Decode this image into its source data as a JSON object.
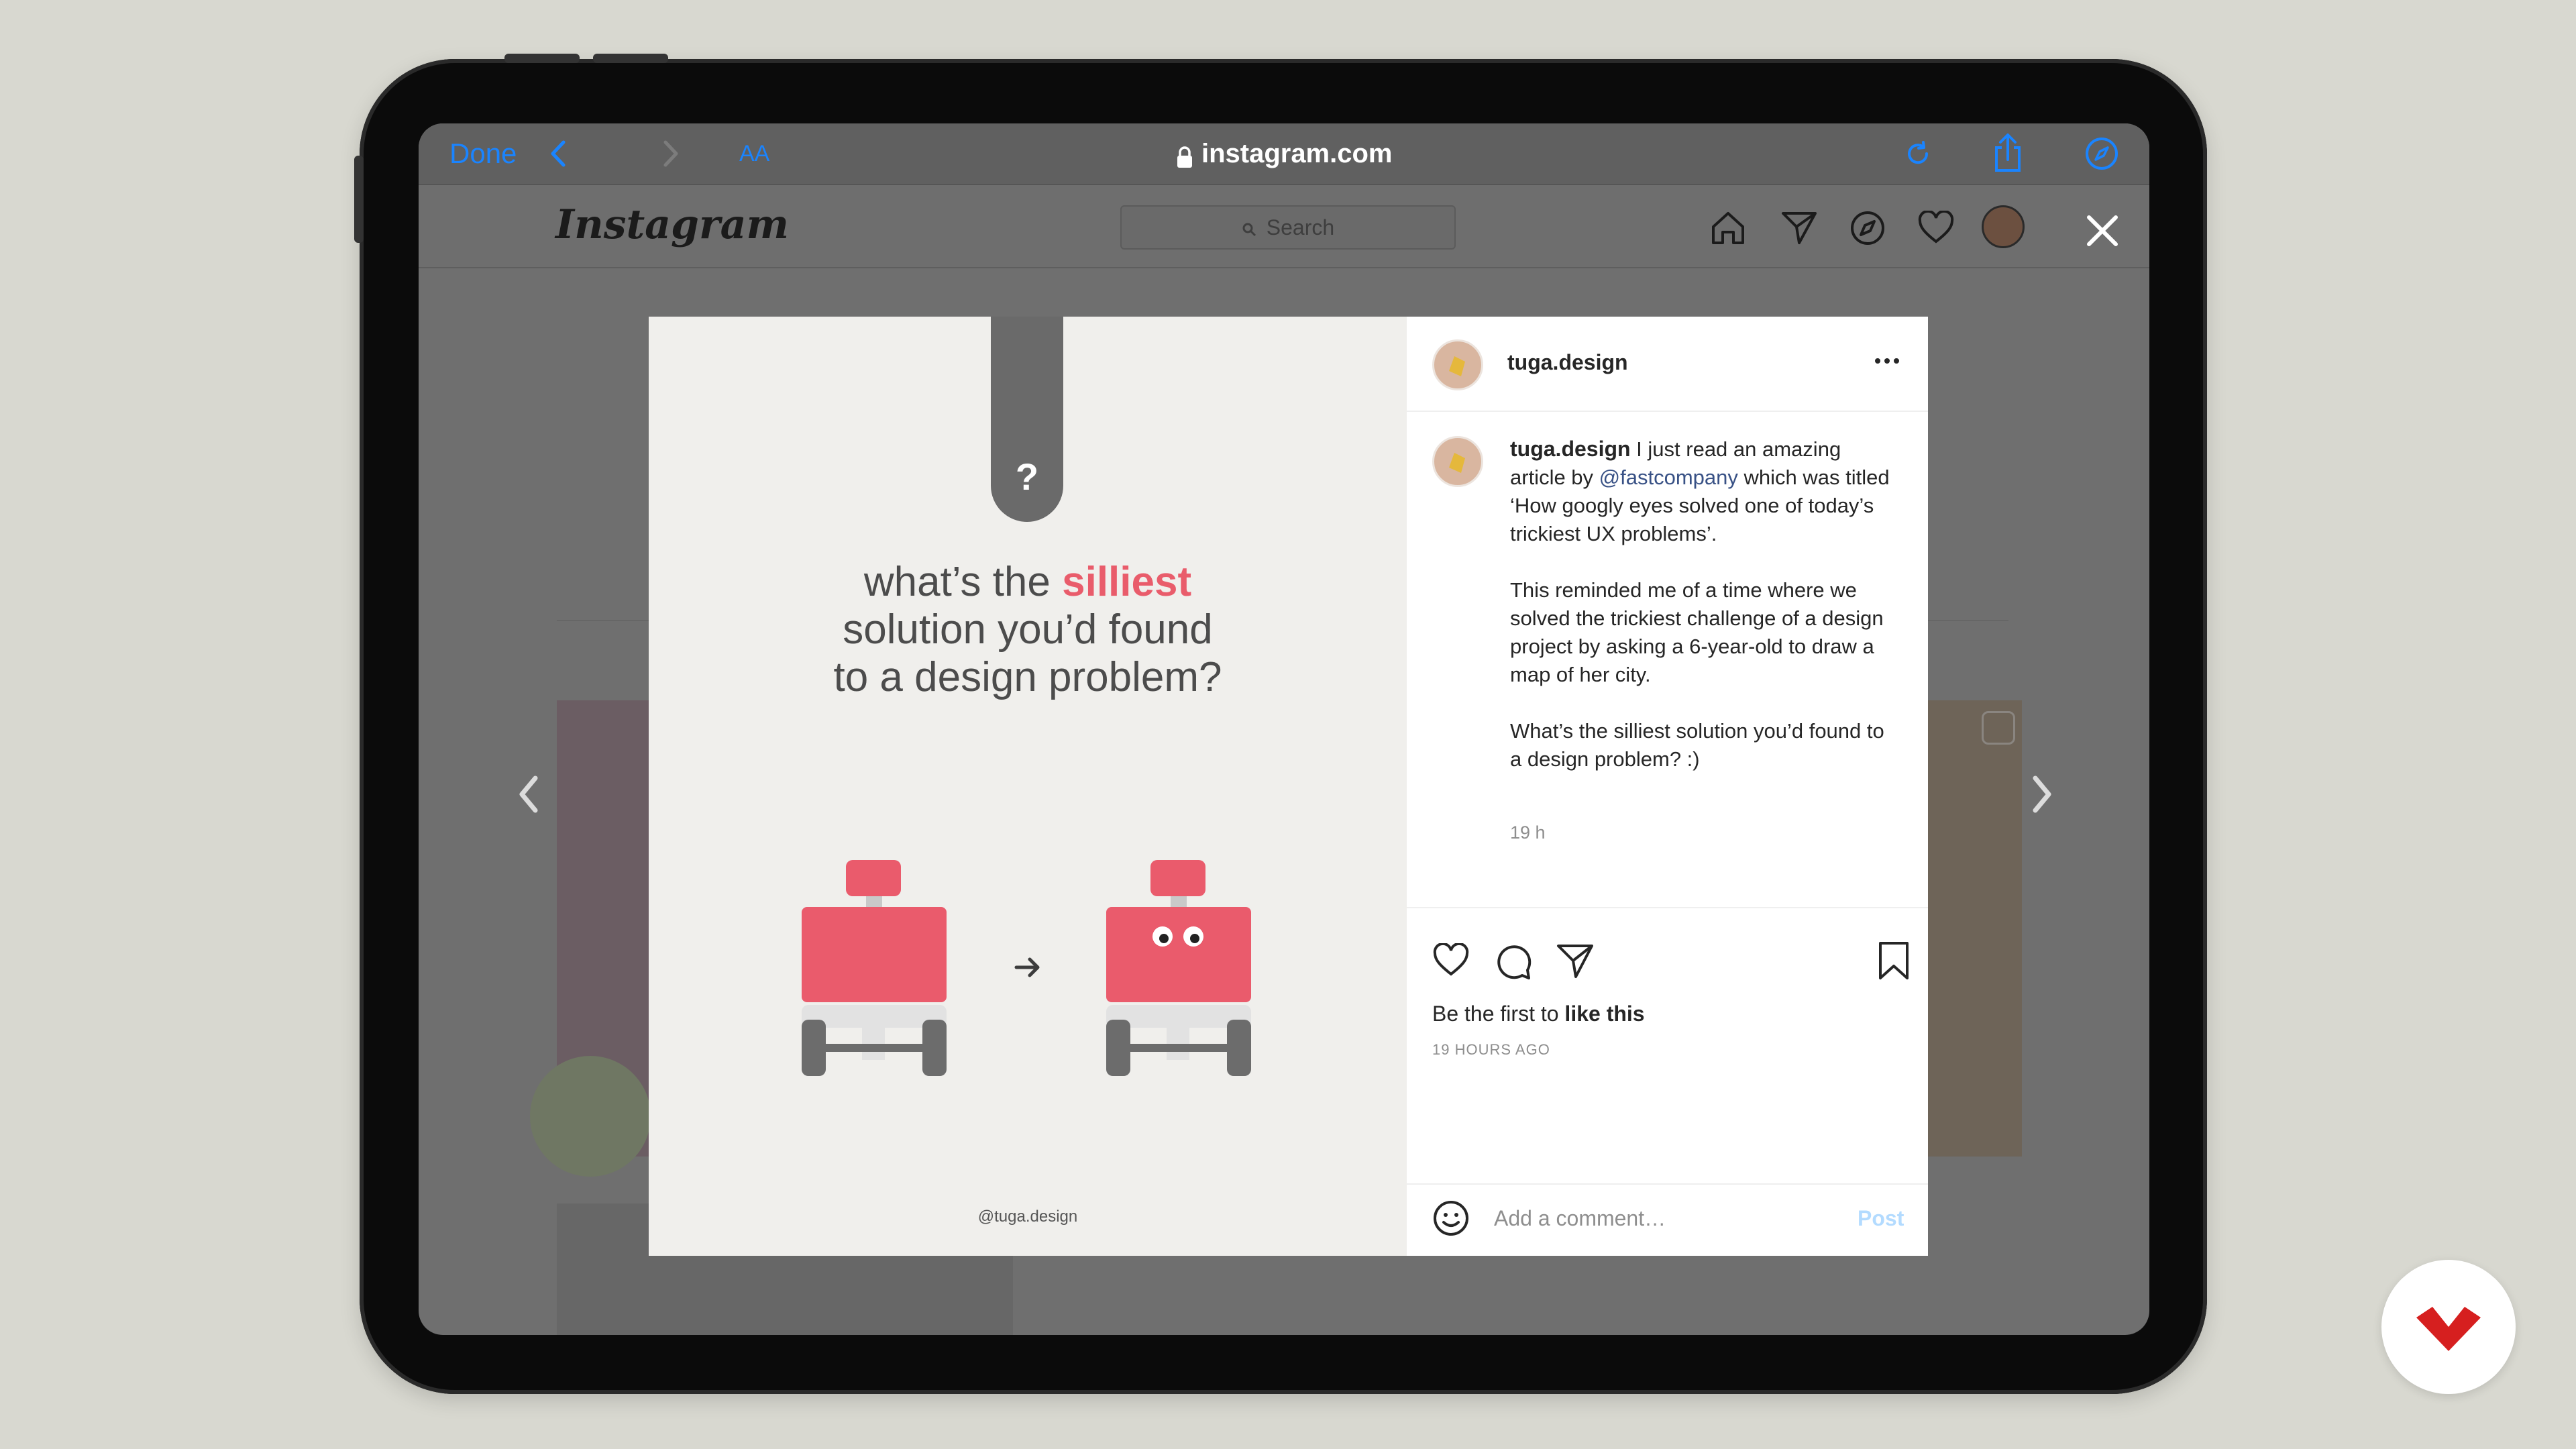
{
  "browser": {
    "done_label": "Done",
    "text_size_label": "AA",
    "url": "instagram.com"
  },
  "instagram": {
    "logo_text": "Instagram",
    "search_placeholder": "Search"
  },
  "post": {
    "image": {
      "tab_symbol": "?",
      "headline_pre": "what’s the ",
      "headline_highlight": "silliest",
      "headline_line2": "solution you’d found",
      "headline_line3": "to a design problem?",
      "watermark": "@tuga.design"
    },
    "author": "tuga.design",
    "caption_intro": " I just read an amazing article by ",
    "caption_mention": "@fastcompany",
    "caption_rest": " which was titled ‘How googly eyes solved one of today’s trickiest UX problems’.",
    "caption_paragraph2": "This reminded me of a time where we solved the trickiest challenge of a design project by asking a 6-year-old to draw a map of her city.",
    "caption_paragraph3": "What’s the silliest solution you’d found to a design problem? :)",
    "caption_time": "19 h",
    "likes_prefix": "Be the first to ",
    "likes_link": "like this",
    "timestamp": "19 HOURS AGO",
    "comment_placeholder": "Add a comment…",
    "post_button": "Post"
  },
  "colors": {
    "accent_red": "#e95c6b",
    "safari_blue": "#1a84ff",
    "link_blue": "#385185",
    "post_button": "#b3dbff"
  }
}
